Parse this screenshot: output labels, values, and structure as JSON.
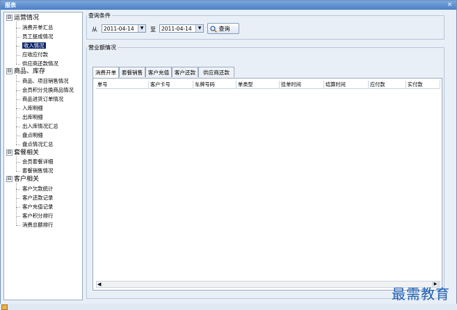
{
  "window": {
    "title": "报表",
    "close_glyph": "×"
  },
  "tree": {
    "groups": [
      {
        "label": "运营情况",
        "toggle": "⊟",
        "children": [
          "消费开单汇总",
          "员工提成情况",
          "收入情况",
          "应收应付款",
          "供应商还款情况"
        ],
        "selected_index": 2
      },
      {
        "label": "商品、库存",
        "toggle": "⊟",
        "children": [
          "商品、项目销售情况",
          "会员积分兑换商品情况",
          "商品进货订单情况",
          "入库明细",
          "出库明细",
          "出入库情况汇总",
          "盘点明细",
          "盘点情况汇总"
        ]
      },
      {
        "label": "套餐相关",
        "toggle": "⊟",
        "children": [
          "会员套餐详细",
          "套餐销售情况"
        ]
      },
      {
        "label": "客户相关",
        "toggle": "⊟",
        "children": [
          "客户欠款统计",
          "客户还款记录",
          "客户充值记录",
          "客户积分排行",
          "消费总额排行"
        ]
      }
    ]
  },
  "query": {
    "legend": "查询条件",
    "from_label": "从",
    "from_date": "2011-04-14",
    "to_label": "至",
    "to_date": "2011-04-14",
    "search_label": "查询"
  },
  "business": {
    "legend": "营业额情况",
    "tabs": [
      "消费开单",
      "套餐销售",
      "客户充值",
      "客户还款",
      "供应商还款"
    ],
    "active_tab": 0,
    "columns": [
      "单号",
      "客户卡号",
      "车牌号码",
      "单类型",
      "挂单时间",
      "结算时间",
      "应付款",
      "实付款"
    ]
  },
  "taskbar": {
    "label": ""
  },
  "watermark": "最需教育"
}
